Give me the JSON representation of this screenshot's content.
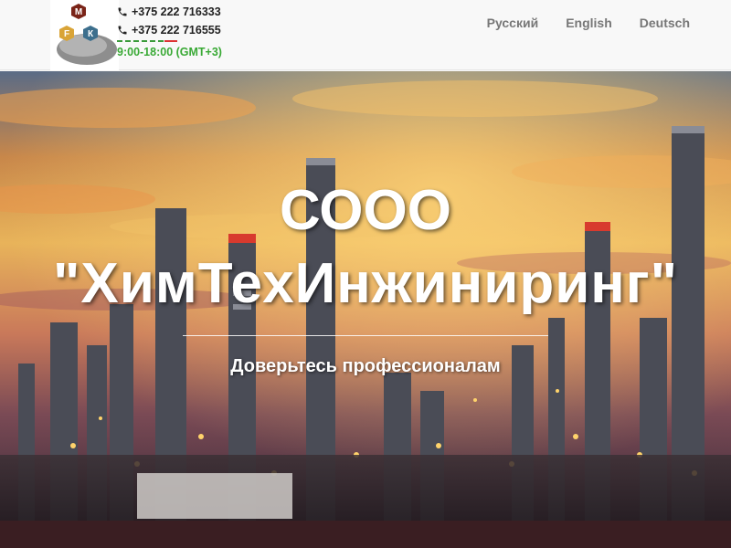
{
  "header": {
    "logo": {
      "letters": [
        "М",
        "F",
        "К"
      ]
    },
    "phones": [
      "+375 222 716333",
      "+375 222 716555"
    ],
    "hours": "9:00-18:00 (GMT+3)",
    "languages": [
      "Русский",
      "English",
      "Deutsch"
    ]
  },
  "hero": {
    "title_line1": "СООО",
    "title_line2": "\"ХимТехИнжиниринг\"",
    "tagline": "Доверьтесь профессионалам"
  },
  "colors": {
    "accent_green": "#39a935",
    "accent_red": "#d33333",
    "nav_text": "#777777"
  },
  "icons": [
    "phone-icon",
    "logo-emblem"
  ]
}
